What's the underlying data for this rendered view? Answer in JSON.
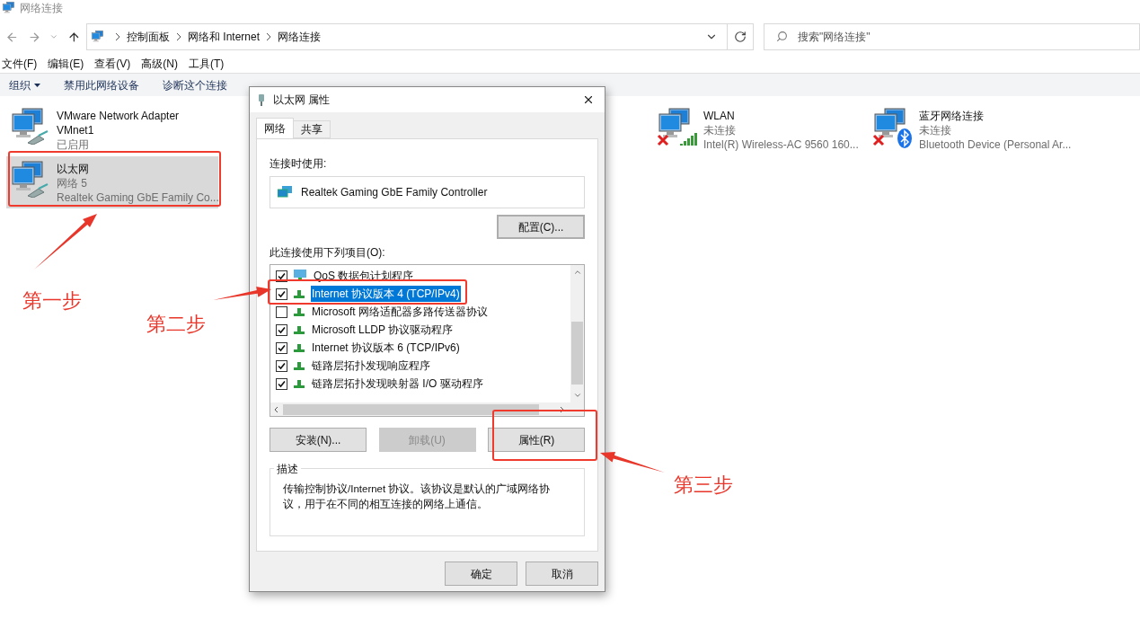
{
  "window": {
    "title": "网络连接"
  },
  "address_bar": {
    "breadcrumbs": [
      "控制面板",
      "网络和 Internet",
      "网络连接"
    ]
  },
  "search": {
    "placeholder": "搜索\"网络连接\""
  },
  "menu": [
    "文件(F)",
    "编辑(E)",
    "查看(V)",
    "高级(N)",
    "工具(T)"
  ],
  "toolbar": [
    {
      "label": "组织",
      "kind": "dropdown"
    },
    {
      "label": "禁用此网络设备",
      "kind": "command"
    },
    {
      "label": "诊断这个连接",
      "kind": "command"
    }
  ],
  "adapters": [
    {
      "name": "VMware Network Adapter VMnet1",
      "status": "已启用",
      "kind": "wired",
      "disconnected": false,
      "selected": false
    },
    {
      "name": "以太网",
      "status": "网络 5",
      "device": "Realtek Gaming GbE Family Co...",
      "kind": "wired",
      "disconnected": false,
      "selected": true
    },
    {
      "name": "WLAN",
      "status": "未连接",
      "device": "Intel(R) Wireless-AC 9560 160...",
      "kind": "wifi",
      "disconnected": true,
      "selected": false
    },
    {
      "name": "蓝牙网络连接",
      "status": "未连接",
      "device": "Bluetooth Device (Personal Ar...",
      "kind": "bluetooth",
      "disconnected": true,
      "selected": false
    }
  ],
  "dialog": {
    "title": "以太网 属性",
    "tabs": [
      {
        "label": "网络",
        "selected": true
      },
      {
        "label": "共享",
        "selected": false
      }
    ],
    "connect_using_label": "连接时使用:",
    "adapter": "Realtek Gaming GbE Family Controller",
    "configure_button": "配置(C)...",
    "items_label": "此连接使用下列项目(O):",
    "items": [
      {
        "label": "QoS 数据包计划程序",
        "checked": true,
        "selected": false,
        "kind": "service"
      },
      {
        "label": "Internet 协议版本 4 (TCP/IPv4)",
        "checked": true,
        "selected": true,
        "kind": "protocol"
      },
      {
        "label": "Microsoft 网络适配器多路传送器协议",
        "checked": false,
        "selected": false,
        "kind": "protocol"
      },
      {
        "label": "Microsoft LLDP 协议驱动程序",
        "checked": true,
        "selected": false,
        "kind": "protocol"
      },
      {
        "label": "Internet 协议版本 6 (TCP/IPv6)",
        "checked": true,
        "selected": false,
        "kind": "protocol"
      },
      {
        "label": "链路层拓扑发现响应程序",
        "checked": true,
        "selected": false,
        "kind": "protocol"
      },
      {
        "label": "链路层拓扑发现映射器 I/O 驱动程序",
        "checked": true,
        "selected": false,
        "kind": "protocol"
      }
    ],
    "buttons": [
      {
        "label": "安装(N)...",
        "disabled": false
      },
      {
        "label": "卸载(U)",
        "disabled": true
      },
      {
        "label": "属性(R)",
        "disabled": false
      }
    ],
    "description_title": "描述",
    "description": "传输控制协议/Internet 协议。该协议是默认的广域网络协议，用于在不同的相互连接的网络上通信。",
    "footer_buttons": [
      "确定",
      "取消"
    ]
  },
  "annotations": [
    {
      "text": "第一步"
    },
    {
      "text": "第二步"
    },
    {
      "text": "第三步"
    }
  ]
}
